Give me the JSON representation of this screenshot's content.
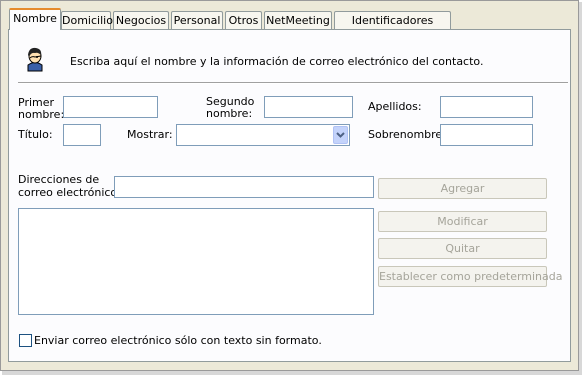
{
  "tabs": [
    {
      "label": "Nombre",
      "active": true
    },
    {
      "label": "Domicilio"
    },
    {
      "label": "Negocios"
    },
    {
      "label": "Personal"
    },
    {
      "label": "Otros"
    },
    {
      "label": "NetMeeting"
    },
    {
      "label": "Identificadores digitales"
    }
  ],
  "header": {
    "icon": "contact-person-icon",
    "description": "Escriba aquí el nombre y la información de correo electrónico del contacto."
  },
  "form": {
    "first_name_label_1": "Primer",
    "first_name_label_2": "nombre:",
    "first_name_value": "",
    "middle_name_label_1": "Segundo",
    "middle_name_label_2": "nombre:",
    "middle_name_value": "",
    "last_name_label": "Apellidos:",
    "last_name_value": "",
    "title_label": "Título:",
    "title_value": "",
    "display_label": "Mostrar:",
    "display_value": "",
    "nickname_label": "Sobrenombre:",
    "nickname_value": ""
  },
  "email": {
    "label_1": "Direcciones de",
    "label_2": "correo electrónico:",
    "input_value": "",
    "add_button": "Agregar",
    "edit_button": "Modificar",
    "remove_button": "Quitar",
    "default_button": "Establecer como predeterminada",
    "plain_text_checkbox": "Enviar correo electrónico sólo con texto sin formato.",
    "plain_text_checked": false
  },
  "colors": {
    "window_bg": "#ece9d8",
    "active_tab_accent": "#e68b2c",
    "field_border": "#7f9db9",
    "disabled_text": "#a5a49a"
  }
}
